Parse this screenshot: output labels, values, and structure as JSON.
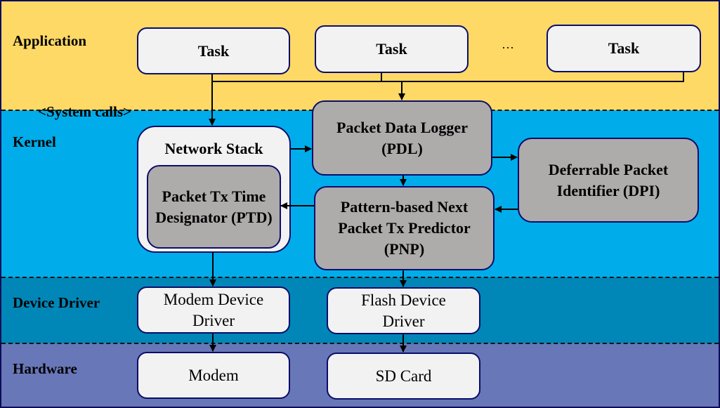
{
  "layers": {
    "application": "Application",
    "kernel": "Kernel",
    "device_driver": "Device Driver",
    "hardware": "Hardware"
  },
  "colors": {
    "application": "#ffd966",
    "kernel": "#00adea",
    "device_driver": "#0087b7",
    "hardware": "#6877b7",
    "white_box": "#f2f2f2",
    "gray_box": "#aeabab",
    "border": "#0c0c6a"
  },
  "application": {
    "tasks": [
      "Task",
      "Task",
      "Task"
    ],
    "ellipsis": "···"
  },
  "system_calls": "<System calls>",
  "kernel": {
    "network_stack": "Network Stack",
    "ptd": "Packet Tx Time Designator (PTD)",
    "pdl": "Packet Data Logger (PDL)",
    "pnp": "Pattern-based Next Packet Tx Predictor (PNP)",
    "dpi": "Deferrable Packet Identifier (DPI)"
  },
  "drivers": {
    "modem_driver": "Modem Device Driver",
    "flash_driver": "Flash Device Driver"
  },
  "hardware": {
    "modem": "Modem",
    "sd_card": "SD Card"
  }
}
